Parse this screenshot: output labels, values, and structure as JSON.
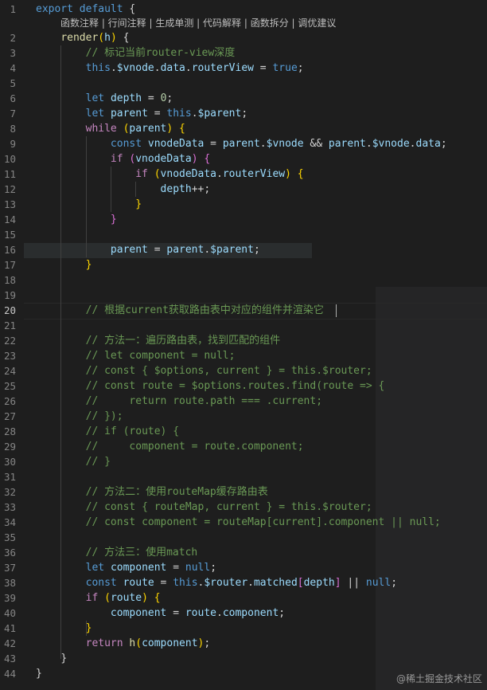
{
  "codelens": "函数注释 | 行间注释 | 生成单测 | 代码解释 | 函数拆分 | 调优建议",
  "watermark": "@稀土掘金技术社区",
  "lines": [
    {
      "n": "1",
      "segs": [
        [
          "b",
          "export"
        ],
        [
          "t",
          " "
        ],
        [
          "b",
          "default"
        ],
        [
          "t",
          " {"
        ]
      ]
    },
    {
      "n": "2",
      "segs": [
        [
          "t",
          "    "
        ],
        [
          "f",
          "render"
        ],
        [
          "y",
          "("
        ],
        [
          "v",
          "h"
        ],
        [
          "y",
          ")"
        ],
        [
          "t",
          " {"
        ]
      ]
    },
    {
      "n": "3",
      "segs": [
        [
          "t",
          "        "
        ],
        [
          "c",
          "// 标记当前router-view深度"
        ]
      ]
    },
    {
      "n": "4",
      "segs": [
        [
          "t",
          "        "
        ],
        [
          "b",
          "this"
        ],
        [
          "t",
          "."
        ],
        [
          "v",
          "$vnode"
        ],
        [
          "t",
          "."
        ],
        [
          "v",
          "data"
        ],
        [
          "t",
          "."
        ],
        [
          "v",
          "routerView"
        ],
        [
          "t",
          " = "
        ],
        [
          "b",
          "true"
        ],
        [
          "t",
          ";"
        ]
      ]
    },
    {
      "n": "5",
      "segs": []
    },
    {
      "n": "6",
      "segs": [
        [
          "t",
          "        "
        ],
        [
          "b",
          "let"
        ],
        [
          "t",
          " "
        ],
        [
          "v",
          "depth"
        ],
        [
          "t",
          " = "
        ],
        [
          "n",
          "0"
        ],
        [
          "t",
          ";"
        ]
      ]
    },
    {
      "n": "7",
      "segs": [
        [
          "t",
          "        "
        ],
        [
          "b",
          "let"
        ],
        [
          "t",
          " "
        ],
        [
          "v",
          "parent"
        ],
        [
          "t",
          " = "
        ],
        [
          "b",
          "this"
        ],
        [
          "t",
          "."
        ],
        [
          "v",
          "$parent"
        ],
        [
          "t",
          ";"
        ]
      ]
    },
    {
      "n": "8",
      "segs": [
        [
          "t",
          "        "
        ],
        [
          "k",
          "while"
        ],
        [
          "t",
          " "
        ],
        [
          "y",
          "("
        ],
        [
          "v",
          "parent"
        ],
        [
          "y",
          ")"
        ],
        [
          "t",
          " "
        ],
        [
          "y",
          "{"
        ]
      ]
    },
    {
      "n": "9",
      "segs": [
        [
          "t",
          "            "
        ],
        [
          "b",
          "const"
        ],
        [
          "t",
          " "
        ],
        [
          "v",
          "vnodeData"
        ],
        [
          "t",
          " = "
        ],
        [
          "v",
          "parent"
        ],
        [
          "t",
          "."
        ],
        [
          "v",
          "$vnode"
        ],
        [
          "t",
          " && "
        ],
        [
          "v",
          "parent"
        ],
        [
          "t",
          "."
        ],
        [
          "v",
          "$vnode"
        ],
        [
          "t",
          "."
        ],
        [
          "v",
          "data"
        ],
        [
          "t",
          ";"
        ]
      ]
    },
    {
      "n": "10",
      "segs": [
        [
          "t",
          "            "
        ],
        [
          "k",
          "if"
        ],
        [
          "t",
          " "
        ],
        [
          "p",
          "("
        ],
        [
          "v",
          "vnodeData"
        ],
        [
          "p",
          ")"
        ],
        [
          "t",
          " "
        ],
        [
          "p",
          "{"
        ]
      ]
    },
    {
      "n": "11",
      "segs": [
        [
          "t",
          "                "
        ],
        [
          "k",
          "if"
        ],
        [
          "t",
          " "
        ],
        [
          "y",
          "("
        ],
        [
          "v",
          "vnodeData"
        ],
        [
          "t",
          "."
        ],
        [
          "v",
          "routerView"
        ],
        [
          "y",
          ")"
        ],
        [
          "t",
          " "
        ],
        [
          "y",
          "{"
        ]
      ]
    },
    {
      "n": "12",
      "segs": [
        [
          "t",
          "                    "
        ],
        [
          "v",
          "depth"
        ],
        [
          "t",
          "++;"
        ]
      ]
    },
    {
      "n": "13",
      "segs": [
        [
          "t",
          "                "
        ],
        [
          "y",
          "}"
        ]
      ]
    },
    {
      "n": "14",
      "segs": [
        [
          "t",
          "            "
        ],
        [
          "p",
          "}"
        ]
      ]
    },
    {
      "n": "15",
      "segs": []
    },
    {
      "n": "16",
      "segs": [
        [
          "t",
          "            "
        ],
        [
          "v",
          "parent"
        ],
        [
          "t",
          " = "
        ],
        [
          "v",
          "parent"
        ],
        [
          "t",
          "."
        ],
        [
          "v",
          "$parent"
        ],
        [
          "t",
          ";"
        ]
      ]
    },
    {
      "n": "17",
      "segs": [
        [
          "t",
          "        "
        ],
        [
          "y",
          "}"
        ]
      ]
    },
    {
      "n": "18",
      "segs": []
    },
    {
      "n": "19",
      "segs": []
    },
    {
      "n": "20",
      "segs": [
        [
          "t",
          "        "
        ],
        [
          "c",
          "// 根据current获取路由表中对应的组件并渲染它"
        ]
      ]
    },
    {
      "n": "21",
      "segs": []
    },
    {
      "n": "22",
      "segs": [
        [
          "t",
          "        "
        ],
        [
          "c",
          "// 方法一：遍历路由表，找到匹配的组件"
        ]
      ]
    },
    {
      "n": "23",
      "segs": [
        [
          "t",
          "        "
        ],
        [
          "c",
          "// let component = null;"
        ]
      ]
    },
    {
      "n": "24",
      "segs": [
        [
          "t",
          "        "
        ],
        [
          "c",
          "// const { $options, current } = this.$router;"
        ]
      ]
    },
    {
      "n": "25",
      "segs": [
        [
          "t",
          "        "
        ],
        [
          "c",
          "// const route = $options.routes.find(route => {"
        ]
      ]
    },
    {
      "n": "26",
      "segs": [
        [
          "t",
          "        "
        ],
        [
          "c",
          "//     return route.path === .current;"
        ]
      ]
    },
    {
      "n": "27",
      "segs": [
        [
          "t",
          "        "
        ],
        [
          "c",
          "// });"
        ]
      ]
    },
    {
      "n": "28",
      "segs": [
        [
          "t",
          "        "
        ],
        [
          "c",
          "// if (route) {"
        ]
      ]
    },
    {
      "n": "29",
      "segs": [
        [
          "t",
          "        "
        ],
        [
          "c",
          "//     component = route.component;"
        ]
      ]
    },
    {
      "n": "30",
      "segs": [
        [
          "t",
          "        "
        ],
        [
          "c",
          "// }"
        ]
      ]
    },
    {
      "n": "31",
      "segs": []
    },
    {
      "n": "32",
      "segs": [
        [
          "t",
          "        "
        ],
        [
          "c",
          "// 方法二：使用routeMap缓存路由表"
        ]
      ]
    },
    {
      "n": "33",
      "segs": [
        [
          "t",
          "        "
        ],
        [
          "c",
          "// const { routeMap, current } = this.$router;"
        ]
      ]
    },
    {
      "n": "34",
      "segs": [
        [
          "t",
          "        "
        ],
        [
          "c",
          "// const component = routeMap[current].component || null;"
        ]
      ]
    },
    {
      "n": "35",
      "segs": []
    },
    {
      "n": "36",
      "segs": [
        [
          "t",
          "        "
        ],
        [
          "c",
          "// 方法三：使用match"
        ]
      ]
    },
    {
      "n": "37",
      "segs": [
        [
          "t",
          "        "
        ],
        [
          "b",
          "let"
        ],
        [
          "t",
          " "
        ],
        [
          "v",
          "component"
        ],
        [
          "t",
          " = "
        ],
        [
          "b",
          "null"
        ],
        [
          "t",
          ";"
        ]
      ]
    },
    {
      "n": "38",
      "segs": [
        [
          "t",
          "        "
        ],
        [
          "b",
          "const"
        ],
        [
          "t",
          " "
        ],
        [
          "v",
          "route"
        ],
        [
          "t",
          " = "
        ],
        [
          "b",
          "this"
        ],
        [
          "t",
          "."
        ],
        [
          "v",
          "$router"
        ],
        [
          "t",
          "."
        ],
        [
          "v",
          "matched"
        ],
        [
          "p",
          "["
        ],
        [
          "v",
          "depth"
        ],
        [
          "p",
          "]"
        ],
        [
          "t",
          " || "
        ],
        [
          "b",
          "null"
        ],
        [
          "t",
          ";"
        ]
      ]
    },
    {
      "n": "39",
      "segs": [
        [
          "t",
          "        "
        ],
        [
          "k",
          "if"
        ],
        [
          "t",
          " "
        ],
        [
          "y",
          "("
        ],
        [
          "v",
          "route"
        ],
        [
          "y",
          ")"
        ],
        [
          "t",
          " "
        ],
        [
          "y",
          "{"
        ]
      ]
    },
    {
      "n": "40",
      "segs": [
        [
          "t",
          "            "
        ],
        [
          "v",
          "component"
        ],
        [
          "t",
          " = "
        ],
        [
          "v",
          "route"
        ],
        [
          "t",
          "."
        ],
        [
          "v",
          "component"
        ],
        [
          "t",
          ";"
        ]
      ]
    },
    {
      "n": "41",
      "segs": [
        [
          "t",
          "        "
        ],
        [
          "y",
          "}"
        ]
      ]
    },
    {
      "n": "42",
      "segs": [
        [
          "t",
          "        "
        ],
        [
          "k",
          "return"
        ],
        [
          "t",
          " "
        ],
        [
          "f",
          "h"
        ],
        [
          "y",
          "("
        ],
        [
          "v",
          "component"
        ],
        [
          "y",
          ")"
        ],
        [
          "t",
          ";"
        ]
      ]
    },
    {
      "n": "43",
      "segs": [
        [
          "t",
          "    "
        ],
        [
          "t",
          "}"
        ]
      ]
    },
    {
      "n": "44",
      "segs": [
        [
          "t",
          "}"
        ]
      ]
    }
  ]
}
